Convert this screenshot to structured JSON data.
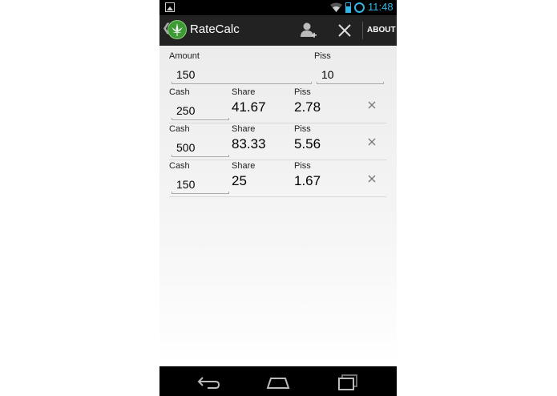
{
  "status_bar": {
    "time": "11:48"
  },
  "action_bar": {
    "title": "RateCalc",
    "about_label": "ABOUT"
  },
  "header": {
    "amount_label": "Amount",
    "amount_value": "150",
    "piss_label": "Piss",
    "piss_value": "10"
  },
  "rows": [
    {
      "cash_label": "Cash",
      "cash": "250",
      "share_label": "Share",
      "share": "41.67",
      "piss_label": "Piss",
      "piss": "2.78"
    },
    {
      "cash_label": "Cash",
      "cash": "500",
      "share_label": "Share",
      "share": "83.33",
      "piss_label": "Piss",
      "piss": "5.56"
    },
    {
      "cash_label": "Cash",
      "cash": "150",
      "share_label": "Share",
      "share": "25",
      "piss_label": "Piss",
      "piss": "1.67"
    }
  ],
  "icons": {
    "logo": "cannabis-leaf-icon",
    "add_person": "add-person-icon",
    "close": "close-icon",
    "remove": "remove-row-icon",
    "back": "back-icon",
    "home": "home-icon",
    "recents": "recent-apps-icon"
  },
  "colors": {
    "accent": "#33b5e5",
    "action_bar": "#222222",
    "logo_green": "#3d9a35"
  }
}
